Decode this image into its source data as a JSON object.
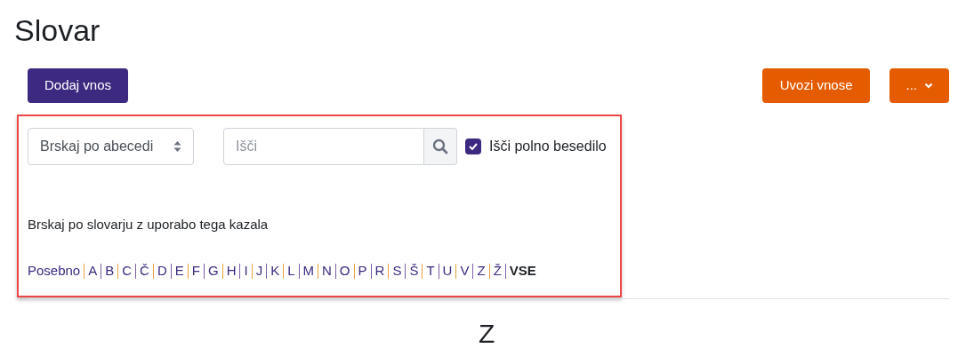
{
  "title": "Slovar",
  "actions": {
    "left": [
      "Dodaj vnos"
    ],
    "right": [
      "Uvozi vnose",
      "..."
    ]
  },
  "browse_select": {
    "value": "Brskaj po abecedi"
  },
  "search": {
    "placeholder": "Išči"
  },
  "full_text": {
    "label": "Išči polno besedilo",
    "checked": true
  },
  "index_hint": "Brskaj po slovarju z uporabo tega kazala",
  "letters": [
    {
      "label": "Posebno",
      "selected": false
    },
    {
      "label": "A",
      "selected": false
    },
    {
      "label": "B",
      "selected": false
    },
    {
      "label": "C",
      "selected": false
    },
    {
      "label": "Č",
      "selected": false
    },
    {
      "label": "D",
      "selected": false
    },
    {
      "label": "E",
      "selected": false
    },
    {
      "label": "F",
      "selected": false
    },
    {
      "label": "G",
      "selected": false
    },
    {
      "label": "H",
      "selected": false
    },
    {
      "label": "I",
      "selected": false
    },
    {
      "label": "J",
      "selected": false
    },
    {
      "label": "K",
      "selected": false
    },
    {
      "label": "L",
      "selected": false
    },
    {
      "label": "M",
      "selected": false
    },
    {
      "label": "N",
      "selected": false
    },
    {
      "label": "O",
      "selected": false
    },
    {
      "label": "P",
      "selected": false
    },
    {
      "label": "R",
      "selected": false
    },
    {
      "label": "S",
      "selected": false
    },
    {
      "label": "Š",
      "selected": false
    },
    {
      "label": "T",
      "selected": false
    },
    {
      "label": "U",
      "selected": false
    },
    {
      "label": "V",
      "selected": false
    },
    {
      "label": "Z",
      "selected": false
    },
    {
      "label": "Ž",
      "selected": false
    },
    {
      "label": "VSE",
      "selected": true
    }
  ],
  "section_heading": "Z"
}
